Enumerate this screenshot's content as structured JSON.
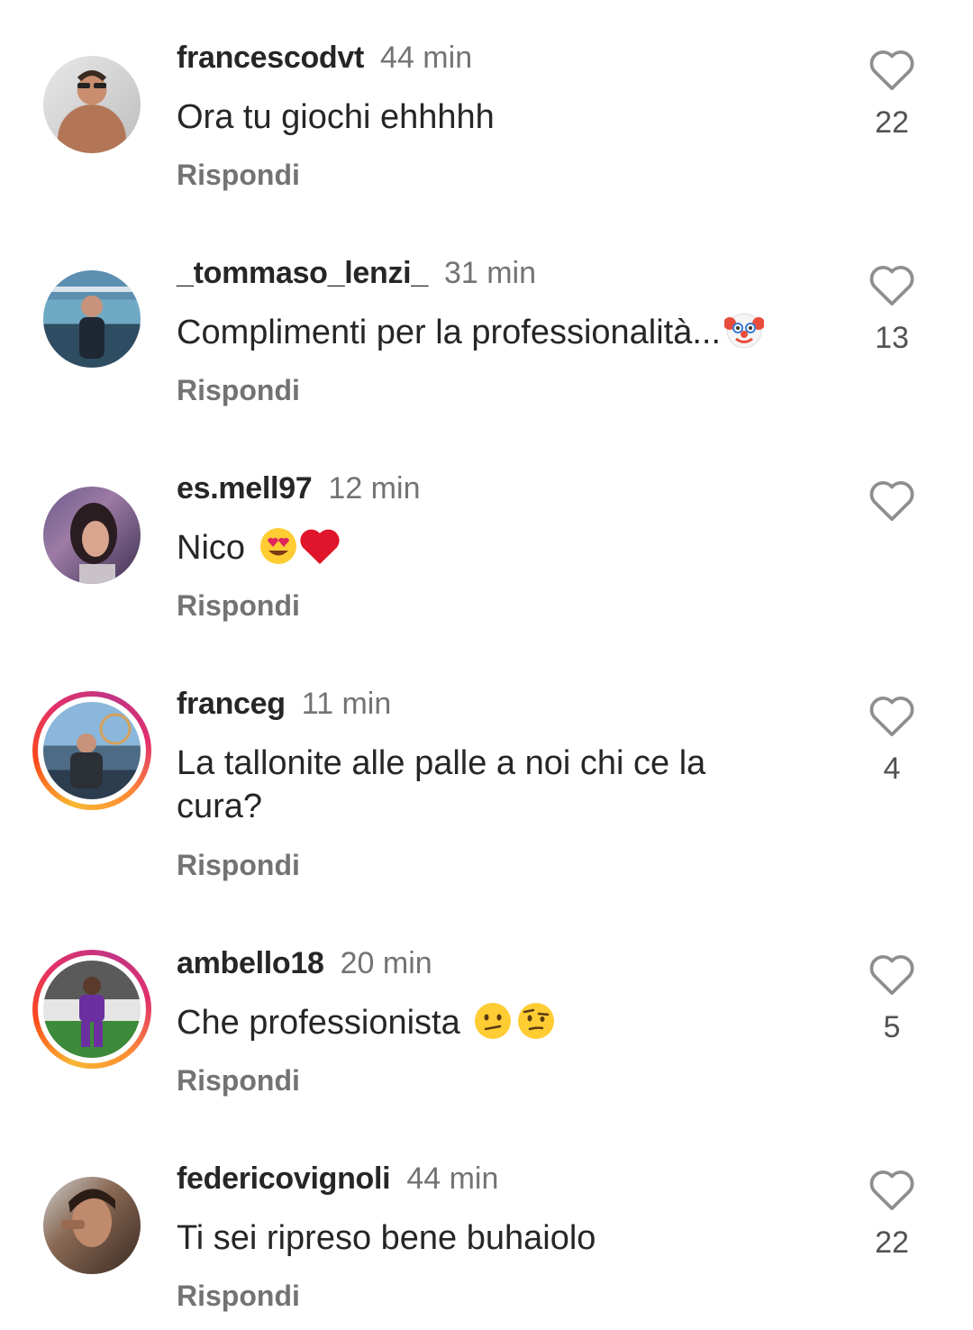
{
  "comments": [
    {
      "username": "francescodvt",
      "time": "44 min",
      "text": "Ora tu giochi ehhhhh",
      "reply_label": "Rispondi",
      "likes": "22",
      "story_ring": false
    },
    {
      "username": "_tommaso_lenzi_",
      "time": "31 min",
      "text": "Complimenti per la professionalità...",
      "emojis": [
        "clown-face"
      ],
      "reply_label": "Rispondi",
      "likes": "13",
      "story_ring": false
    },
    {
      "username": "es.mell97",
      "time": "12 min",
      "text": "Nico",
      "emojis": [
        "heart-eyes",
        "red-heart"
      ],
      "reply_label": "Rispondi",
      "likes": "",
      "story_ring": false
    },
    {
      "username": "franceg",
      "time": "11 min",
      "text": "La tallonite alle palle a noi chi ce la cura?",
      "reply_label": "Rispondi",
      "likes": "4",
      "story_ring": true
    },
    {
      "username": "ambello18",
      "time": "20 min",
      "text": "Che professionista",
      "emojis": [
        "confused-face",
        "raised-eyebrow-face"
      ],
      "reply_label": "Rispondi",
      "likes": "5",
      "story_ring": true
    },
    {
      "username": "federicovignoli",
      "time": "44 min",
      "text": "Ti sei ripreso bene buhaiolo",
      "reply_label": "Rispondi",
      "likes": "22",
      "story_ring": false
    }
  ],
  "icons": {
    "like": "heart-outline-icon"
  },
  "colors": {
    "text": "#262626",
    "secondary": "#737373",
    "story_ring": "#e1306c"
  }
}
